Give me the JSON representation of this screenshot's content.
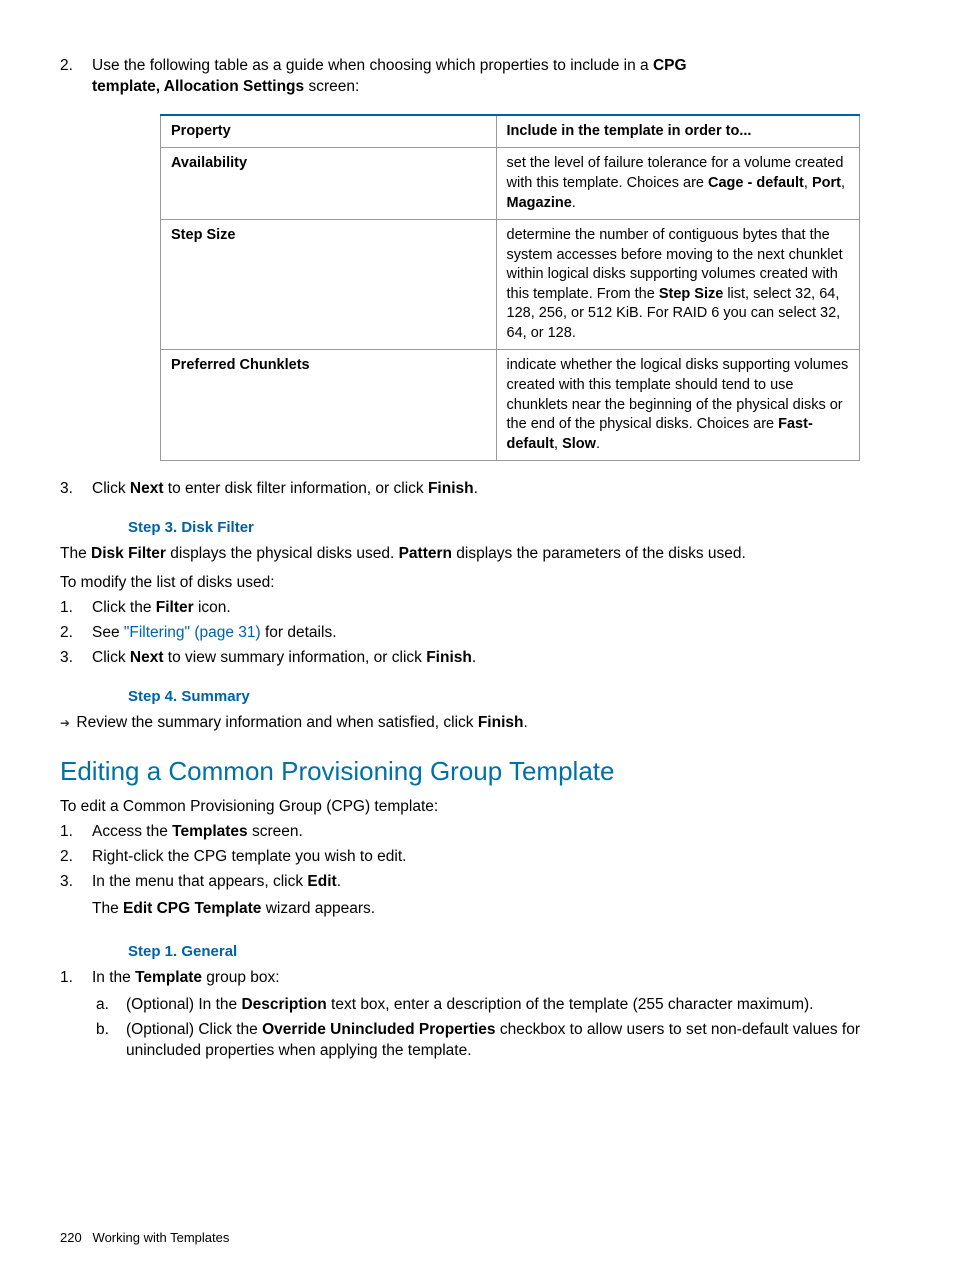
{
  "step2": {
    "num": "2.",
    "text_a": "Use the following table as a guide when choosing which properties to include in a ",
    "bold_a": "CPG",
    "bold_b": "template, Allocation Settings",
    "text_b": " screen:"
  },
  "table": {
    "header_property": "Property",
    "header_include": "Include in the template in order to...",
    "rows": [
      {
        "property": "Availability",
        "desc_a": "set the level of failure tolerance for a volume created with this template. Choices are ",
        "bold_a": "Cage - default",
        "mid_a": ", ",
        "bold_b": "Port",
        "mid_b": ", ",
        "bold_c": "Magazine",
        "end": "."
      },
      {
        "property": "Step Size",
        "desc_a": "determine the number of contiguous bytes that the system accesses before moving to the next chunklet within logical disks supporting volumes created with this template. From the ",
        "bold_a": "Step Size",
        "desc_b": " list, select 32, 64, 128, 256, or 512 KiB. For RAID 6 you can select 32, 64, or 128."
      },
      {
        "property": "Preferred Chunklets",
        "desc_a": "indicate whether the logical disks supporting volumes created with this template should tend to use chunklets near the beginning of the physical disks or the end of the physical disks. Choices are ",
        "bold_a": "Fast- default",
        "mid_a": ", ",
        "bold_b": "Slow",
        "end": "."
      }
    ]
  },
  "step3_item": {
    "num": "3.",
    "a": "Click ",
    "bold_a": "Next",
    "b": " to enter disk filter information, or click ",
    "bold_b": "Finish",
    "c": "."
  },
  "step3_heading": "Step 3. Disk Filter",
  "step3_p1_a": "The ",
  "step3_p1_bold_a": "Disk Filter",
  "step3_p1_b": " displays the physical disks used. ",
  "step3_p1_bold_b": "Pattern",
  "step3_p1_c": " displays the parameters of the disks used.",
  "step3_p2": "To modify the list of disks used:",
  "step3_list": [
    {
      "num": "1.",
      "a": "Click the ",
      "bold": "Filter",
      "b": " icon."
    },
    {
      "num": "2.",
      "a": "See ",
      "link": "\"Filtering\" (page 31)",
      "b": " for details."
    },
    {
      "num": "3.",
      "a": "Click ",
      "bold_a": "Next",
      "b": " to view summary information, or click ",
      "bold_b": "Finish",
      "c": "."
    }
  ],
  "step4_heading": "Step 4. Summary",
  "step4_bullet_a": "Review the summary information and when satisfied, click ",
  "step4_bullet_bold": "Finish",
  "step4_bullet_b": ".",
  "section_heading": "Editing a Common Provisioning Group Template",
  "edit_intro": "To edit a Common Provisioning Group (CPG) template:",
  "edit_list": [
    {
      "num": "1.",
      "a": "Access the ",
      "bold": "Templates",
      "b": " screen."
    },
    {
      "num": "2.",
      "a": "Right-click the CPG template you wish to edit."
    },
    {
      "num": "3.",
      "a": "In the menu that appears, click ",
      "bold": "Edit",
      "b": ".",
      "line2_a": "The ",
      "line2_bold": "Edit CPG Template",
      "line2_b": " wizard appears."
    }
  ],
  "step1_heading": "Step 1. General",
  "step1_item_num": "1.",
  "step1_item_a": "In the ",
  "step1_item_bold": "Template",
  "step1_item_b": " group box:",
  "step1_sub": [
    {
      "let": "a.",
      "a": "(Optional) In the ",
      "bold": "Description",
      "b": " text box, enter a description of the template (255 character maximum)."
    },
    {
      "let": "b.",
      "a": "(Optional) Click the ",
      "bold": "Override Unincluded Properties",
      "b": " checkbox to allow users to set non-default values for unincluded properties when applying the template."
    }
  ],
  "footer_page": "220",
  "footer_title": "Working with Templates"
}
